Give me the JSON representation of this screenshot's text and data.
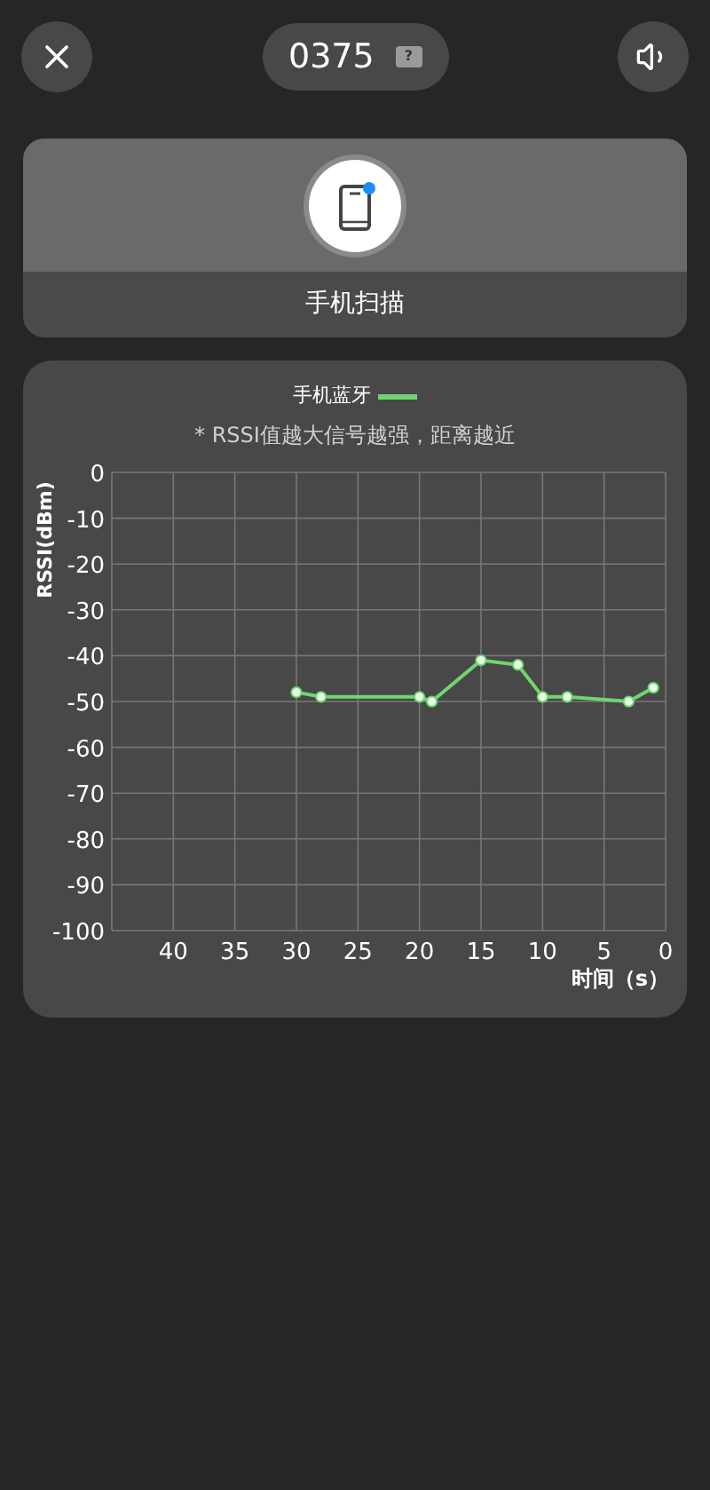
{
  "header": {
    "device_id": "0375",
    "battery": "?"
  },
  "scan_card": {
    "label": "手机扫描",
    "indicator_on": true
  },
  "chart_card": {
    "note": "* RSSI值越大信号越强，距离越近",
    "chart_data": {
      "type": "line",
      "grid": true,
      "xlabel": "时间（s）",
      "ylabel": "RSSI(dBm)",
      "xlim": [
        45,
        0
      ],
      "ylim": [
        -100,
        0
      ],
      "xticks": [
        40,
        35,
        30,
        25,
        20,
        15,
        10,
        5,
        0
      ],
      "yticks": [
        0,
        -10,
        -20,
        -30,
        -40,
        -50,
        -60,
        -70,
        -80,
        -90,
        -100
      ],
      "x": [
        30,
        28,
        20,
        19,
        15,
        12,
        10,
        8,
        3,
        1
      ],
      "series": [
        {
          "name": "手机蓝牙",
          "color": "#6fd66f",
          "marker": "circle",
          "values": [
            -48,
            -49,
            -49,
            -50,
            -41,
            -42,
            -49,
            -49,
            -50,
            -47
          ]
        }
      ]
    }
  }
}
